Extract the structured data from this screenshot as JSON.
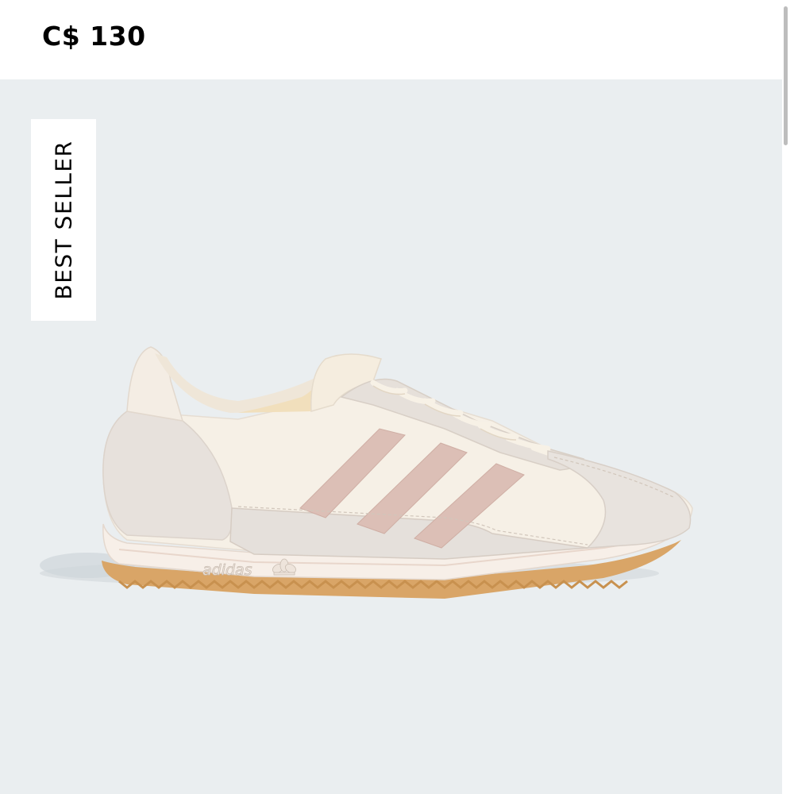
{
  "product": {
    "price": "C$ 130",
    "badge": "BEST SELLER",
    "image_icon": "sneaker-image",
    "logo_text": "adidas"
  },
  "colors": {
    "panel_background": "#eaeef0",
    "stripe": "#dcbfb6",
    "upper": "#f6f0e6",
    "suede": "#e6e0da",
    "gum_sole": "#d9a567"
  }
}
